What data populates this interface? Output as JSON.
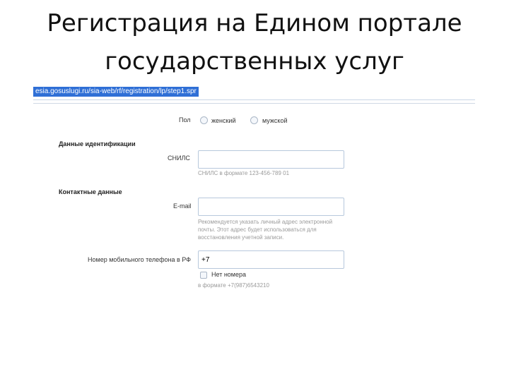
{
  "slide": {
    "title_line1": "Регистрация на Едином портале",
    "title_line2": "государственных услуг"
  },
  "browser": {
    "url": "esia.gosuslugi.ru/sia-web/rf/registration/lp/step1.spr"
  },
  "form": {
    "gender_label": "Пол",
    "gender_female": "женский",
    "gender_male": "мужской",
    "identification_section": "Данные идентификации",
    "snils_label": "СНИЛС",
    "snils_value": "",
    "snils_hint": "СНИЛС в формате 123-456-789 01",
    "contacts_section": "Контактные данные",
    "email_label": "E-mail",
    "email_value": "",
    "email_hint_line1": "Рекомендуется указать личный адрес электронной",
    "email_hint_line2": "почты. Этот адрес будет использоваться для",
    "email_hint_line3": "восстановления учетной записи.",
    "phone_label": "Номер мобильного телефона в РФ",
    "phone_value": "+7",
    "no_number_label": "Нет номера",
    "phone_hint": "в формате +7(987)6543210"
  }
}
